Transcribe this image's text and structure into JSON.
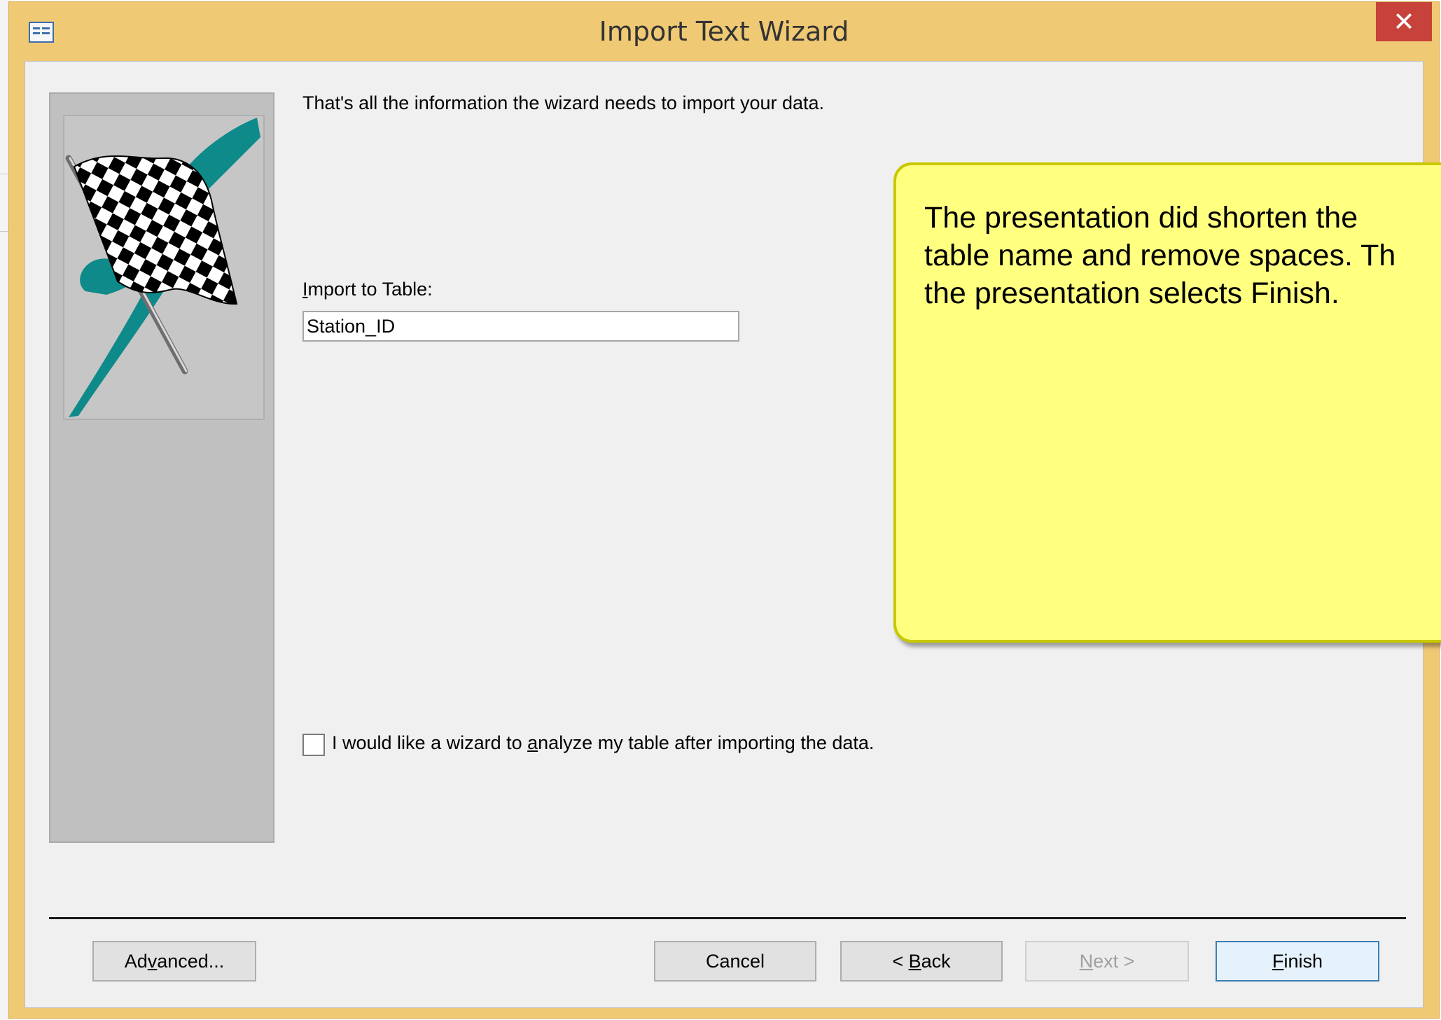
{
  "window": {
    "title": "Import Text Wizard",
    "close_glyph": "✕",
    "app_icon": "form-icon"
  },
  "wizard": {
    "intro_text": "That's all the information the wizard needs to import your data.",
    "import_label_hotkey": "I",
    "import_label_rest": "mport to Table:",
    "table_name_value": "Station_ID",
    "side_image": "checkered-flag-icon",
    "analyze_checkbox": {
      "checked": false,
      "label_before": "I would like a wizard to ",
      "label_hotkey": "a",
      "label_after": "nalyze my table after importing the data."
    }
  },
  "buttons": {
    "advanced": {
      "before": "Ad",
      "hotkey": "v",
      "after": "anced..."
    },
    "cancel": "Cancel",
    "back": {
      "before": "< ",
      "hotkey": "B",
      "after": "ack"
    },
    "next": {
      "hotkey": "N",
      "after": "ext >",
      "disabled": true
    },
    "finish": {
      "hotkey": "F",
      "after": "inish",
      "default": true
    }
  },
  "callout": {
    "lines": [
      "The presentation did shorten the",
      "table name and remove spaces. Th",
      "the presentation selects Finish."
    ]
  },
  "colors": {
    "window_frame": "#f0c974",
    "close_button": "#c7423a",
    "client_bg": "#f0f0f0",
    "callout_fill": "#ffff80",
    "flag_teal": "#0e8a8a"
  }
}
